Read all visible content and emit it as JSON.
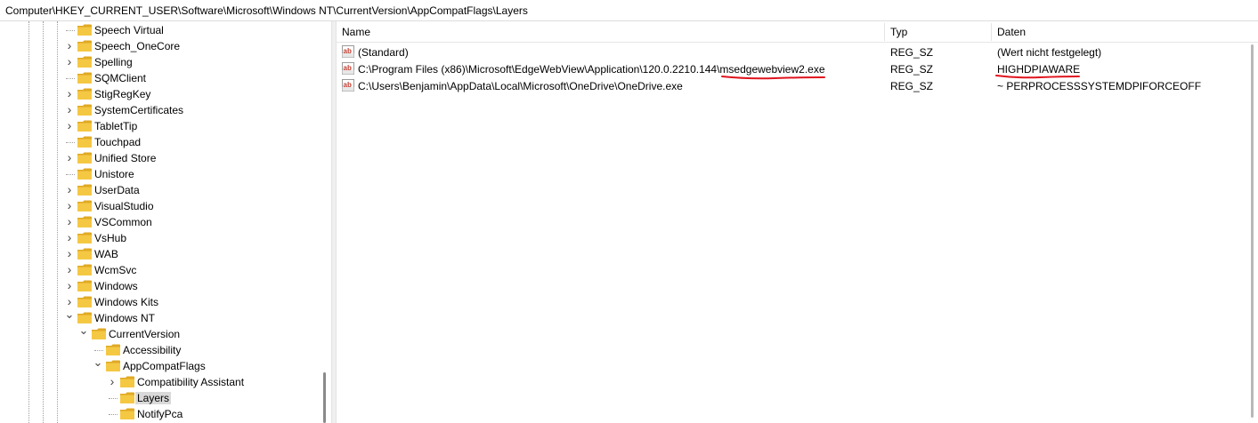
{
  "address_bar": {
    "path": "Computer\\HKEY_CURRENT_USER\\Software\\Microsoft\\Windows NT\\CurrentVersion\\AppCompatFlags\\Layers"
  },
  "tree": {
    "items": [
      {
        "label": "Speech Virtual",
        "depth": 0,
        "expander": "none"
      },
      {
        "label": "Speech_OneCore",
        "depth": 0,
        "expander": "collapsed"
      },
      {
        "label": "Spelling",
        "depth": 0,
        "expander": "collapsed"
      },
      {
        "label": "SQMClient",
        "depth": 0,
        "expander": "none"
      },
      {
        "label": "StigRegKey",
        "depth": 0,
        "expander": "collapsed"
      },
      {
        "label": "SystemCertificates",
        "depth": 0,
        "expander": "collapsed"
      },
      {
        "label": "TabletTip",
        "depth": 0,
        "expander": "collapsed"
      },
      {
        "label": "Touchpad",
        "depth": 0,
        "expander": "none"
      },
      {
        "label": "Unified Store",
        "depth": 0,
        "expander": "collapsed"
      },
      {
        "label": "Unistore",
        "depth": 0,
        "expander": "none"
      },
      {
        "label": "UserData",
        "depth": 0,
        "expander": "collapsed"
      },
      {
        "label": "VisualStudio",
        "depth": 0,
        "expander": "collapsed"
      },
      {
        "label": "VSCommon",
        "depth": 0,
        "expander": "collapsed"
      },
      {
        "label": "VsHub",
        "depth": 0,
        "expander": "collapsed"
      },
      {
        "label": "WAB",
        "depth": 0,
        "expander": "collapsed"
      },
      {
        "label": "WcmSvc",
        "depth": 0,
        "expander": "collapsed"
      },
      {
        "label": "Windows",
        "depth": 0,
        "expander": "collapsed"
      },
      {
        "label": "Windows Kits",
        "depth": 0,
        "expander": "collapsed"
      },
      {
        "label": "Windows NT",
        "depth": 0,
        "expander": "expanded"
      },
      {
        "label": "CurrentVersion",
        "depth": 1,
        "expander": "expanded"
      },
      {
        "label": "Accessibility",
        "depth": 2,
        "expander": "none"
      },
      {
        "label": "AppCompatFlags",
        "depth": 2,
        "expander": "expanded"
      },
      {
        "label": "Compatibility Assistant",
        "depth": 3,
        "expander": "collapsed"
      },
      {
        "label": "Layers",
        "depth": 3,
        "expander": "none",
        "selected": true
      },
      {
        "label": "NotifyPca",
        "depth": 3,
        "expander": "none"
      }
    ]
  },
  "list": {
    "columns": {
      "name": "Name",
      "type": "Typ",
      "data": "Daten"
    },
    "rows": [
      {
        "name": "(Standard)",
        "type": "REG_SZ",
        "data": "(Wert nicht festgelegt)"
      },
      {
        "name": "C:\\Program Files (x86)\\Microsoft\\EdgeWebView\\Application\\120.0.2210.144\\msedgewebview2.exe",
        "type": "REG_SZ",
        "data": "HIGHDPIAWARE"
      },
      {
        "name": "C:\\Users\\Benjamin\\AppData\\Local\\Microsoft\\OneDrive\\OneDrive.exe",
        "type": "REG_SZ",
        "data": "~ PERPROCESSSYSTEMDPIFORCEOFF"
      }
    ]
  },
  "icons": {
    "folder": "folder-icon",
    "string_value": "reg-string-icon",
    "expand": "chevron-right-icon",
    "collapse": "chevron-down-icon"
  },
  "colors": {
    "folder_fill": "#f5c843",
    "folder_back": "#e0a925",
    "annotation": "#e0141e",
    "selection": "#d9d9d9"
  }
}
